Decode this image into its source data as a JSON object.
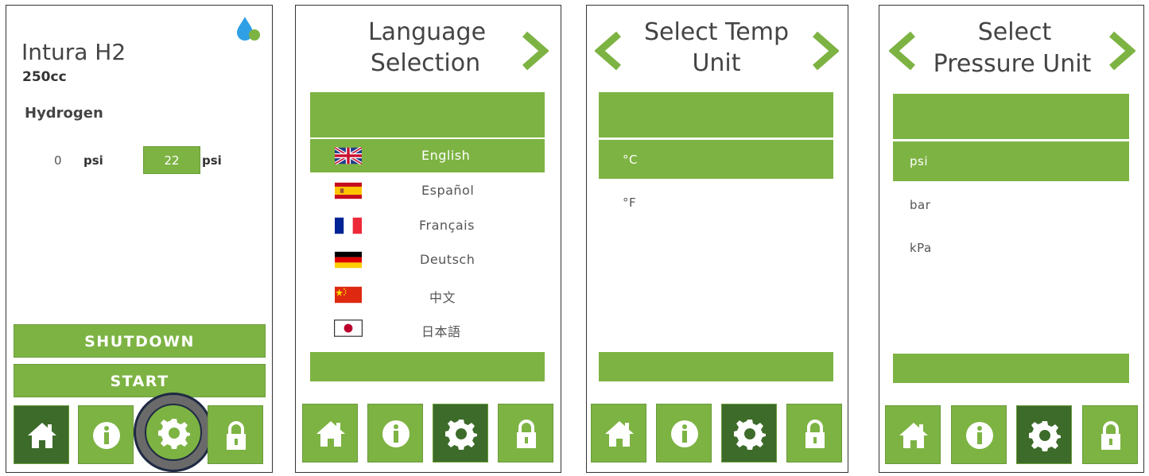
{
  "colors": {
    "accent": "#7db343",
    "active": "#3d6b2a",
    "brand_blue": "#2f9fe6"
  },
  "screen1": {
    "app_name": "Intura H2",
    "capacity": "250cc",
    "gas_label": "Hydrogen",
    "current_value": "0",
    "current_unit": "psi",
    "setpoint_value": "22",
    "setpoint_unit": "psi",
    "shutdown_label": "SHUTDOWN",
    "start_label": "START",
    "nav": [
      "home-icon",
      "info-icon",
      "gear-icon",
      "lock-icon"
    ],
    "active_nav": "gear-icon"
  },
  "screen2": {
    "title_line1": "Language",
    "title_line2": "Selection",
    "selected": "English",
    "languages": [
      {
        "label": "English",
        "flag": "uk-flag-icon"
      },
      {
        "label": "Español",
        "flag": "spain-flag-icon"
      },
      {
        "label": "Français",
        "flag": "france-flag-icon"
      },
      {
        "label": "Deutsch",
        "flag": "germany-flag-icon"
      },
      {
        "label": "中文",
        "flag": "china-flag-icon"
      },
      {
        "label": "日本語",
        "flag": "japan-flag-icon"
      }
    ]
  },
  "screen3": {
    "title_line1": "Select Temp",
    "title_line2": "Unit",
    "selected": "°C",
    "options": [
      "°C",
      "°F"
    ]
  },
  "screen4": {
    "title_line1": "Select",
    "title_line2": "Pressure Unit",
    "selected": "psi",
    "options": [
      "psi",
      "bar",
      "kPa"
    ]
  }
}
